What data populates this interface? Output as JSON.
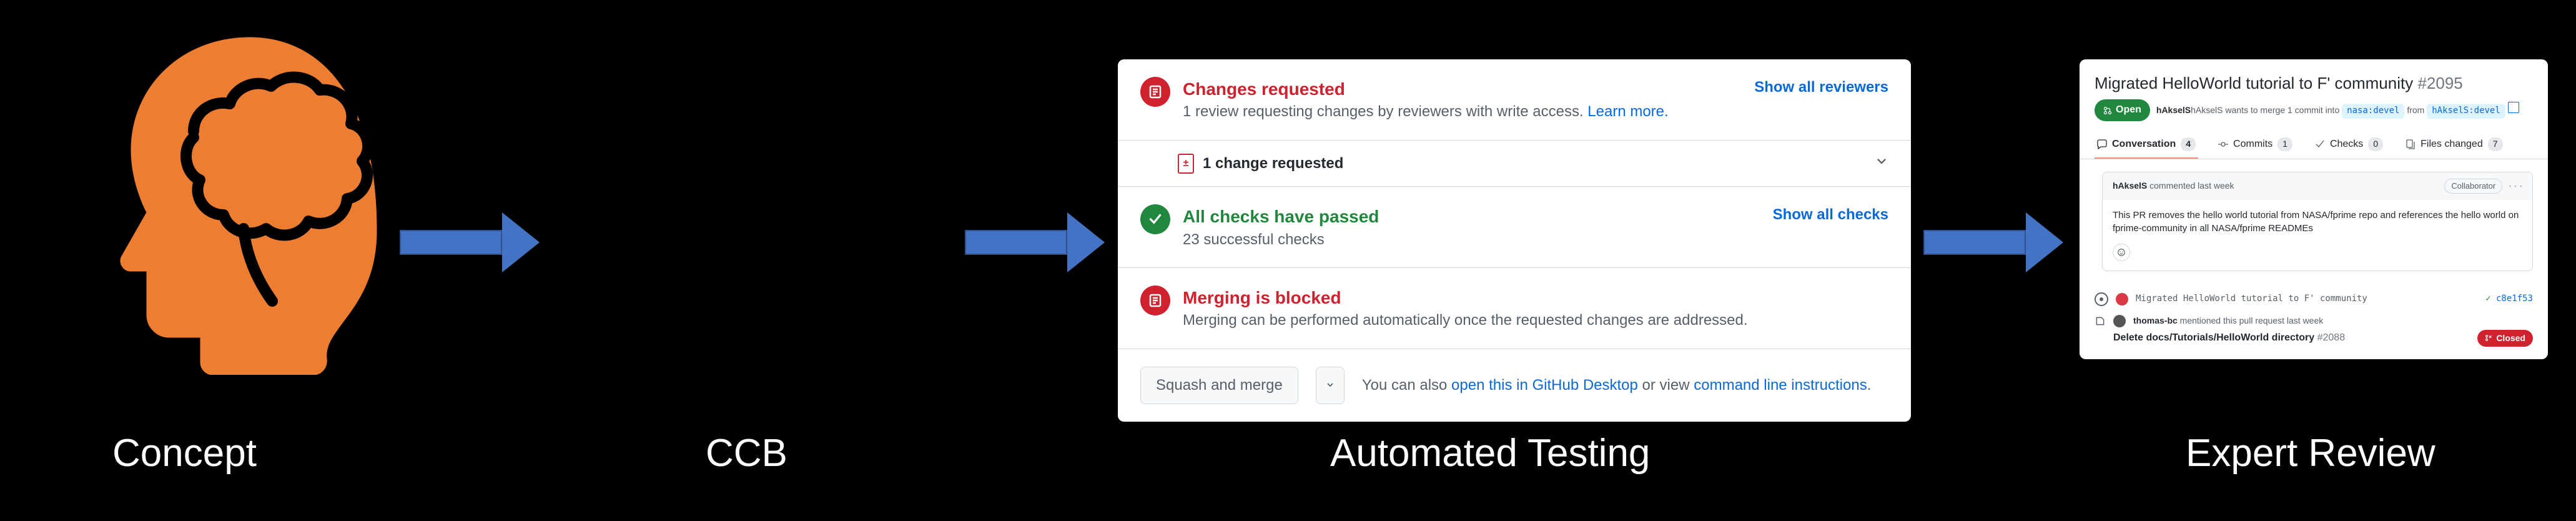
{
  "captions": {
    "concept": "Concept",
    "ccb": "CCB",
    "automated": "Automated Testing",
    "expert": "Expert Review"
  },
  "automated_panel": {
    "changes_requested": {
      "title": "Changes requested",
      "sub": "1 review requesting changes by reviewers with write access. ",
      "learn_more": "Learn more.",
      "link": "Show all reviewers"
    },
    "change_line": {
      "text": "1 change requested"
    },
    "checks": {
      "title": "All checks have passed",
      "sub": "23 successful checks",
      "link": "Show all checks"
    },
    "blocked": {
      "title": "Merging is blocked",
      "sub": "Merging can be performed automatically once the requested changes are addressed."
    },
    "footer": {
      "squash_btn": "Squash and merge",
      "also_prefix": "You can also ",
      "desktop_link": "open this in GitHub Desktop",
      "or": " or view ",
      "cli_link": "command line instructions",
      "dot": "."
    }
  },
  "pr_panel": {
    "title": "Migrated HelloWorld tutorial to F' community",
    "number": "#2095",
    "open_label": "Open",
    "merge_prefix": "hAkselS wants to merge 1 commit into ",
    "base_branch": "nasa:devel",
    "from": " from ",
    "head_branch": "hAkselS:devel",
    "tabs": {
      "conversation": "Conversation",
      "conversation_count": "4",
      "commits": "Commits",
      "commits_count": "1",
      "checks": "Checks",
      "checks_count": "0",
      "files": "Files changed",
      "files_count": "7"
    },
    "comment": {
      "author": "hAkselS",
      "when": " commented last week",
      "label": "Collaborator",
      "body": "This PR removes the hello world tutorial from NASA/fprime repo and references the hello world on fprime-community in all NASA/fprime READMEs"
    },
    "commit_line": {
      "msg": "Migrated HelloWorld tutorial to F' community",
      "hash": "c8e1f53"
    },
    "mention": {
      "user": "thomas-bc",
      "text": " mentioned this pull request last week",
      "ref_title": "Delete docs/Tutorials/HelloWorld directory",
      "ref_num": "#2088",
      "closed": "Closed"
    }
  }
}
